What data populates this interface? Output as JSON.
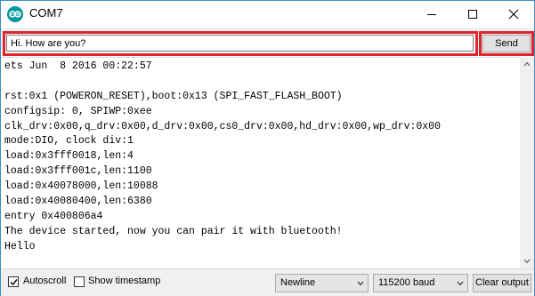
{
  "window": {
    "title": "COM7"
  },
  "input_row": {
    "message_value": "Hi. How are you?",
    "send_label": "Send"
  },
  "output": {
    "lines": [
      "ets Jun  8 2016 00:22:57",
      "",
      "rst:0x1 (POWERON_RESET),boot:0x13 (SPI_FAST_FLASH_BOOT)",
      "configsip: 0, SPIWP:0xee",
      "clk_drv:0x00,q_drv:0x00,d_drv:0x00,cs0_drv:0x00,hd_drv:0x00,wp_drv:0x00",
      "mode:DIO, clock div:1",
      "load:0x3fff0018,len:4",
      "load:0x3fff001c,len:1100",
      "load:0x40078000,len:10088",
      "load:0x40080400,len:6380",
      "entry 0x400806a4",
      "The device started, now you can pair it with bluetooth!",
      "Hello"
    ]
  },
  "bottom_bar": {
    "autoscroll_label": "Autoscroll",
    "autoscroll_checked": true,
    "timestamp_label": "Show timestamp",
    "timestamp_checked": false,
    "line_ending": "Newline",
    "baud_rate": "115200 baud",
    "clear_label": "Clear output"
  },
  "icons": {
    "app": "arduino-logo-icon",
    "minimize": "minimize-icon",
    "maximize": "maximize-icon",
    "close": "close-icon",
    "scroll_up": "chevron-up-icon",
    "scroll_down": "chevron-down-icon",
    "dropdown": "chevron-down-icon",
    "check": "checkmark-icon"
  },
  "colors": {
    "highlight": "#e0252f",
    "arduino_teal": "#00979d"
  }
}
